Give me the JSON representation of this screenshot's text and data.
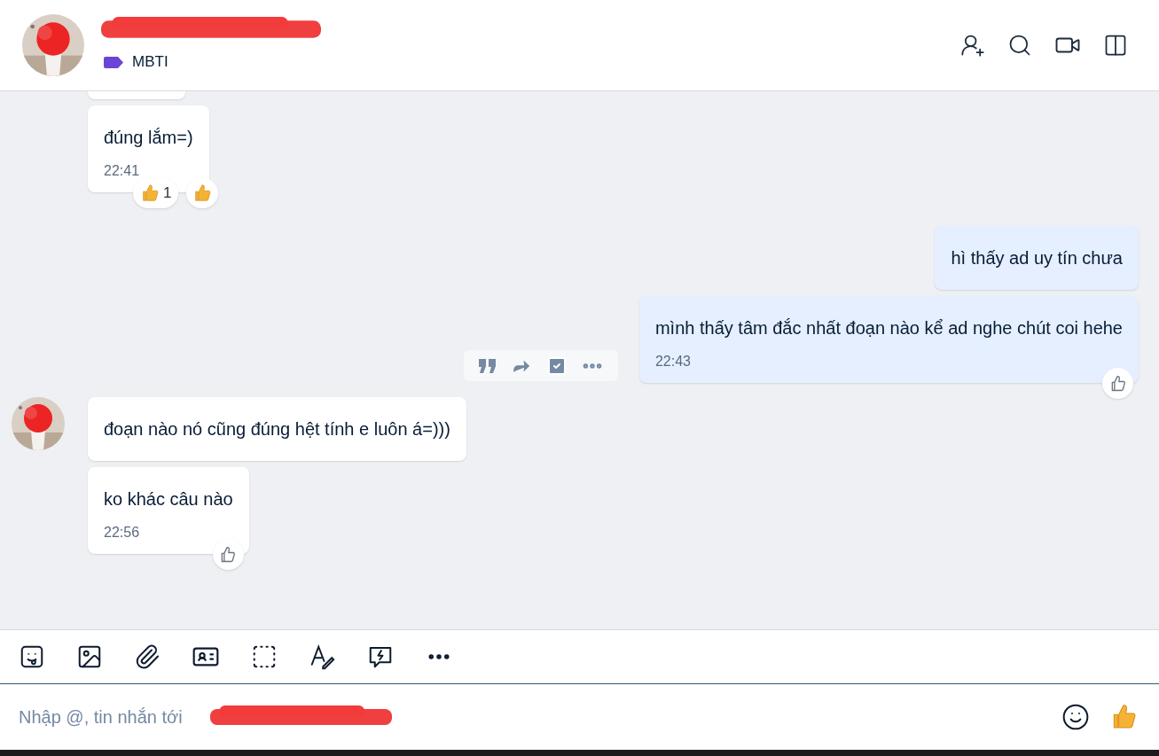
{
  "header": {
    "tag": "MBTI"
  },
  "messages": [
    {
      "kind": "incoming",
      "text": "đúng lắm=)",
      "time": "22:41",
      "avatar": false,
      "hover_actions": false,
      "reaction_count": "1",
      "liked": true
    },
    {
      "kind": "outgoing",
      "text": "hì thấy ad uy tín chưa",
      "avatar": false,
      "hover_actions": false
    },
    {
      "kind": "outgoing",
      "text": "mình thấy tâm đắc nhất đoạn nào kể ad nghe chút coi hehe",
      "time": "22:43",
      "avatar": false,
      "hover_actions": true,
      "liked": false
    },
    {
      "kind": "incoming",
      "text": "đoạn nào nó cũng đúng hệt tính e luôn á=)))",
      "avatar": true,
      "hover_actions": false
    },
    {
      "kind": "incoming",
      "text": "ko khác câu nào",
      "time": "22:56",
      "avatar": false,
      "hover_actions": false,
      "liked": false
    }
  ],
  "composer": {
    "placeholder": "Nhập @, tin nhắn tới"
  }
}
